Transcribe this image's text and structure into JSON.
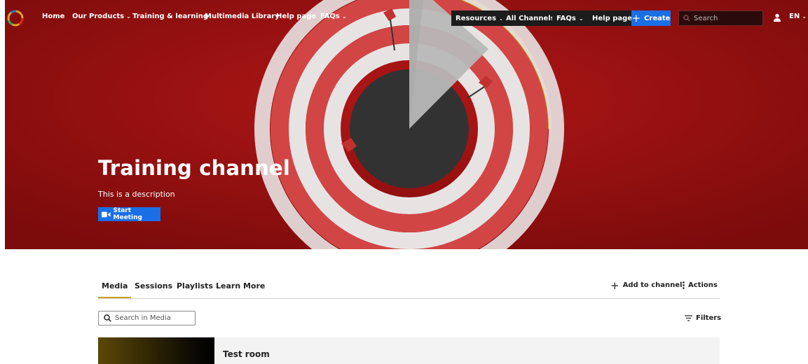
{
  "nav": {
    "left_items": [
      {
        "label": "Home"
      },
      {
        "label": "Our Products",
        "dropdown": true
      },
      {
        "label": "Training & learning"
      },
      {
        "label": "Multimedia Library"
      },
      {
        "label": "Help page"
      },
      {
        "label": "FAQs",
        "dropdown": true
      }
    ],
    "right_items": [
      {
        "label": "Resources",
        "dropdown": true
      },
      {
        "label": "All Channels"
      },
      {
        "label": "FAQs",
        "dropdown": true
      },
      {
        "label": "Help page"
      }
    ],
    "create_label": "Create",
    "search_placeholder": "Search",
    "language": "EN"
  },
  "hero": {
    "title": "Training channel",
    "description": "This is a description",
    "start_meeting_label": "Start Meeting"
  },
  "tabs": {
    "items": [
      {
        "label": "Media",
        "active": true
      },
      {
        "label": "Sessions"
      },
      {
        "label": "Playlists"
      },
      {
        "label": "Learn More"
      }
    ],
    "add_to_channel_label": "Add to channel",
    "actions_label": "Actions"
  },
  "media": {
    "search_placeholder": "Search in Media",
    "filters_label": "Filters",
    "items": [
      {
        "title": "Test room"
      }
    ]
  },
  "colors": {
    "hero_background": "#8e0f0f",
    "accent_blue": "#1b6fe6",
    "active_tab_underline": "#c7a023",
    "card_background": "#f3f3f3"
  },
  "icons": {
    "logo": "logo-ring-icon",
    "create": "plus-icon",
    "search": "search-icon",
    "user": "user-icon",
    "start_meeting": "video-camera-icon",
    "add_to_channel": "plus-icon",
    "actions": "more-vertical-icon",
    "filters": "filter-icon"
  }
}
